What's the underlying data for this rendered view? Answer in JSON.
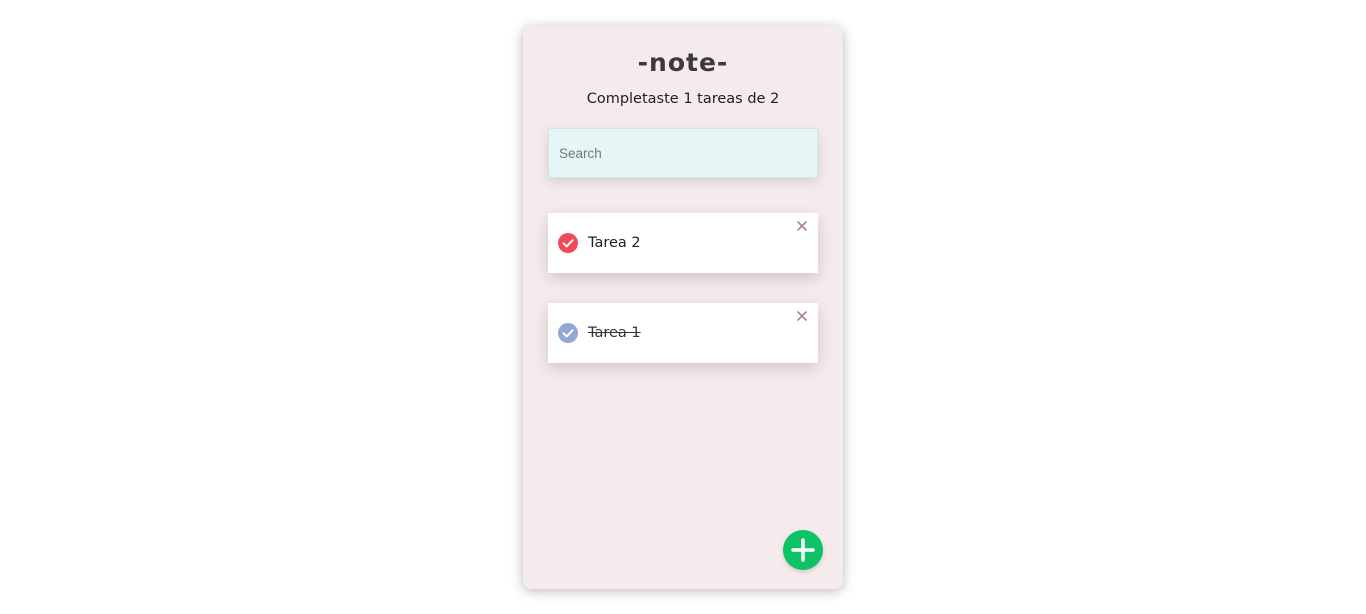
{
  "app": {
    "title": "-note-",
    "counter_text": "Completaste 1 tareas de 2"
  },
  "search": {
    "placeholder": "Search",
    "value": ""
  },
  "todos": [
    {
      "text": "Tarea 2",
      "completed": false,
      "check_icon": "check-circle-icon",
      "delete_icon": "close-icon"
    },
    {
      "text": "Tarea 1",
      "completed": true,
      "check_icon": "check-circle-icon",
      "delete_icon": "close-icon"
    }
  ],
  "add_button": {
    "icon": "plus-icon"
  },
  "colors": {
    "card_background": "#f5ebec",
    "search_background": "#e6f6f6",
    "check_active": "#ef4a57",
    "check_done": "#8fa9d4",
    "delete_icon": "#a58891",
    "add_button": "#0ec266"
  }
}
